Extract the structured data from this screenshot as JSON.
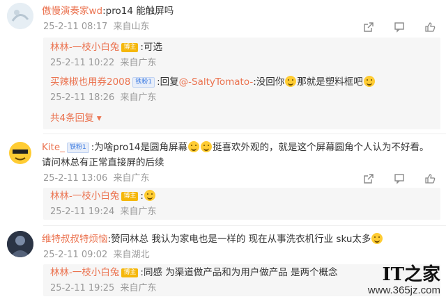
{
  "comments": [
    {
      "user": "傲慢演奏家wd",
      "text": ":pro14 能触屏吗",
      "time": "25-2-11 08:17",
      "location": "来自山东",
      "replies": [
        {
          "user": "林林-一枝小白兔",
          "badge": "博主",
          "text": ":可选",
          "time": "25-2-11 10:22",
          "location": "来自广东"
        },
        {
          "user": "买辣椒也用券2008",
          "badge": "铁粉1",
          "text_a": ":回复",
          "mention": "@-SaltyTomato-",
          "text_b": ":没回你",
          "text_c": "那就是塑料框吧",
          "time": "25-2-11 18:26",
          "location": "来自广东"
        }
      ],
      "more_replies": "共4条回复"
    },
    {
      "user": "Kite_",
      "badge": "铁粉1",
      "text_a": ":为啥pro14是圆角屏幕",
      "text_b": "挺喜欢外观的，就是这个屏幕圆角个人认为不好看。",
      "text_line2": "请问林总有正常直接屏的后续",
      "time": "25-2-11 13:06",
      "location": "来自广东",
      "replies": [
        {
          "user": "林林-一枝小白兔",
          "badge": "博主",
          "text": ":",
          "time": "25-2-11 19:24",
          "location": "来自广东"
        }
      ]
    },
    {
      "user": "维特叔叔特烦恼",
      "text": ":赞同林总 我认为家电也是一样的 现在从事洗衣机行业 sku太多",
      "time": "25-2-11 09:02",
      "location": "来自湖北",
      "replies": [
        {
          "user": "林林-一枝小白兔",
          "badge": "博主",
          "text": ":同感 为渠道做产品和为用户做产品 是两个概念",
          "time": "25-2-11 19:25",
          "location": "来自广东"
        }
      ]
    }
  ],
  "watermark": {
    "logo": "IT之家",
    "url": "www.365jz.com"
  },
  "colors": {
    "username": "#eb7350",
    "meta": "#999999",
    "reply_bg": "#f6f6f6",
    "badge_main": "#f5b70a"
  }
}
